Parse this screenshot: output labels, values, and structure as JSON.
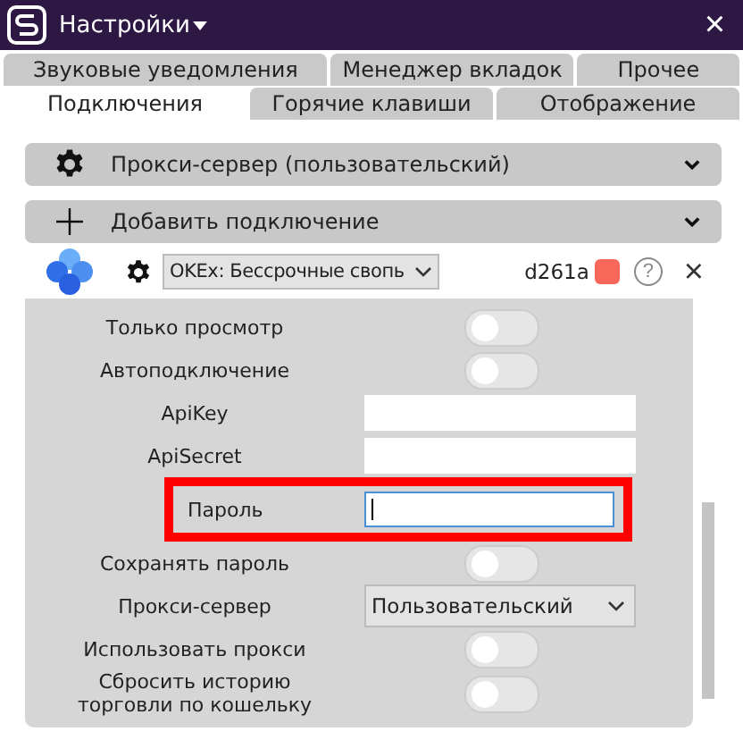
{
  "window": {
    "title": "Настройки",
    "close": "×"
  },
  "tab_rows": [
    [
      {
        "label": "Звуковые уведомления",
        "selected": false
      },
      {
        "label": "Менеджер вкладок",
        "selected": false
      },
      {
        "label": "Прочее",
        "selected": false
      }
    ],
    [
      {
        "label": "Подключения",
        "selected": true
      },
      {
        "label": "Горячие клавиши",
        "selected": false
      },
      {
        "label": "Отображение",
        "selected": false
      }
    ]
  ],
  "sections": [
    {
      "kind": "gear",
      "label": "Прокси-сервер (пользовательский)"
    },
    {
      "kind": "plus",
      "label": "Добавить подключение"
    }
  ],
  "connection": {
    "exchange": "OKEx: Бессрочные свопь",
    "account": "d261a",
    "color": "#f7685a",
    "help": "?",
    "remove": "×"
  },
  "settings": [
    {
      "kind": "toggle",
      "label": "Только просмотр",
      "on": false
    },
    {
      "kind": "toggle",
      "label": "Автоподключение",
      "on": false
    },
    {
      "kind": "input",
      "label": "ApiKey",
      "focused": false,
      "highlighted": false
    },
    {
      "kind": "input",
      "label": "ApiSecret",
      "focused": false,
      "highlighted": false
    },
    {
      "kind": "input",
      "label": "Пароль",
      "focused": true,
      "highlighted": true
    },
    {
      "kind": "toggle",
      "label": "Сохранять пароль",
      "on": false
    },
    {
      "kind": "select",
      "label": "Прокси-сервер",
      "value": "Пользовательский"
    },
    {
      "kind": "toggle",
      "label": "Использовать прокси",
      "on": false
    },
    {
      "kind": "toggle",
      "label": "Сбросить историю торговли по кошельку",
      "on": false
    }
  ]
}
